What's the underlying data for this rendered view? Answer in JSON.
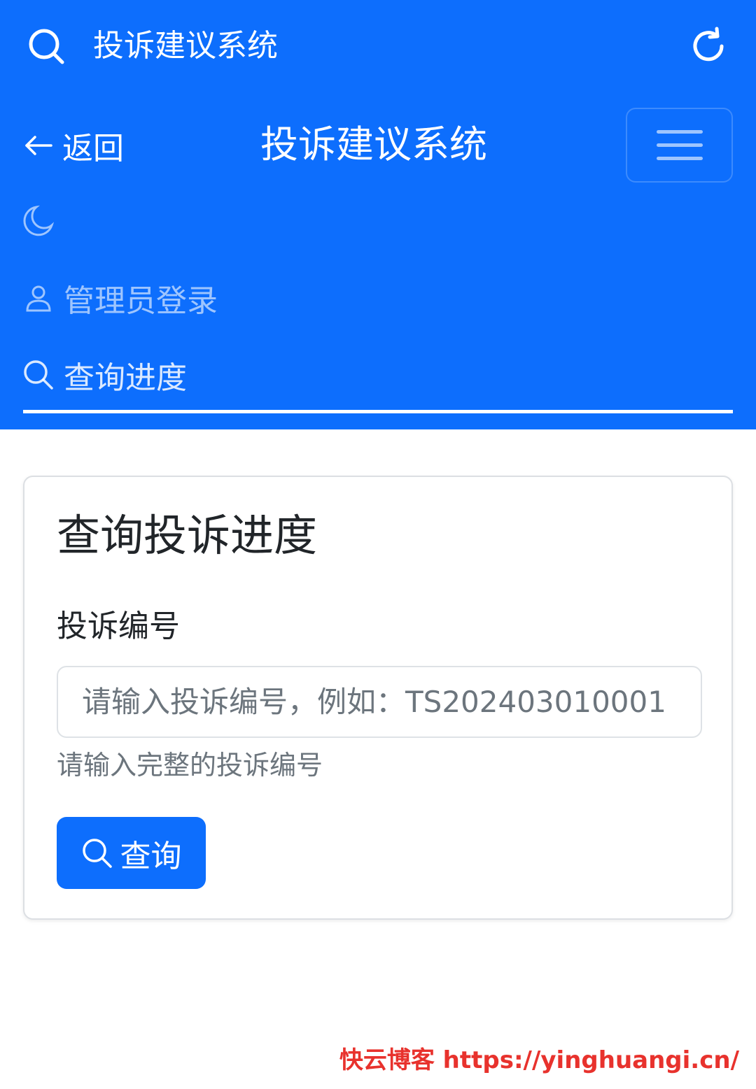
{
  "topbar": {
    "title": "投诉建议系统",
    "search_icon": "search-icon",
    "refresh_icon": "refresh-icon"
  },
  "navbar": {
    "back_label": "返回",
    "brand": "投诉建议系统",
    "toggler_icon": "hamburger-icon",
    "theme_icon": "moon-icon",
    "items": [
      {
        "label": "管理员登录",
        "icon": "person-icon",
        "active": false
      },
      {
        "label": "查询进度",
        "icon": "search-icon",
        "active": true
      }
    ]
  },
  "card": {
    "title": "查询投诉进度",
    "field_label": "投诉编号",
    "field_value": "",
    "field_placeholder": "请输入投诉编号，例如：TS202403010001",
    "field_help": "请输入完整的投诉编号",
    "submit_label": "查询"
  },
  "watermark": "快云博客 https://yinghuangi.cn/",
  "colors": {
    "primary": "#0d6efd",
    "text": "#212529",
    "muted": "#6c757d",
    "watermark": "#e8322d"
  }
}
